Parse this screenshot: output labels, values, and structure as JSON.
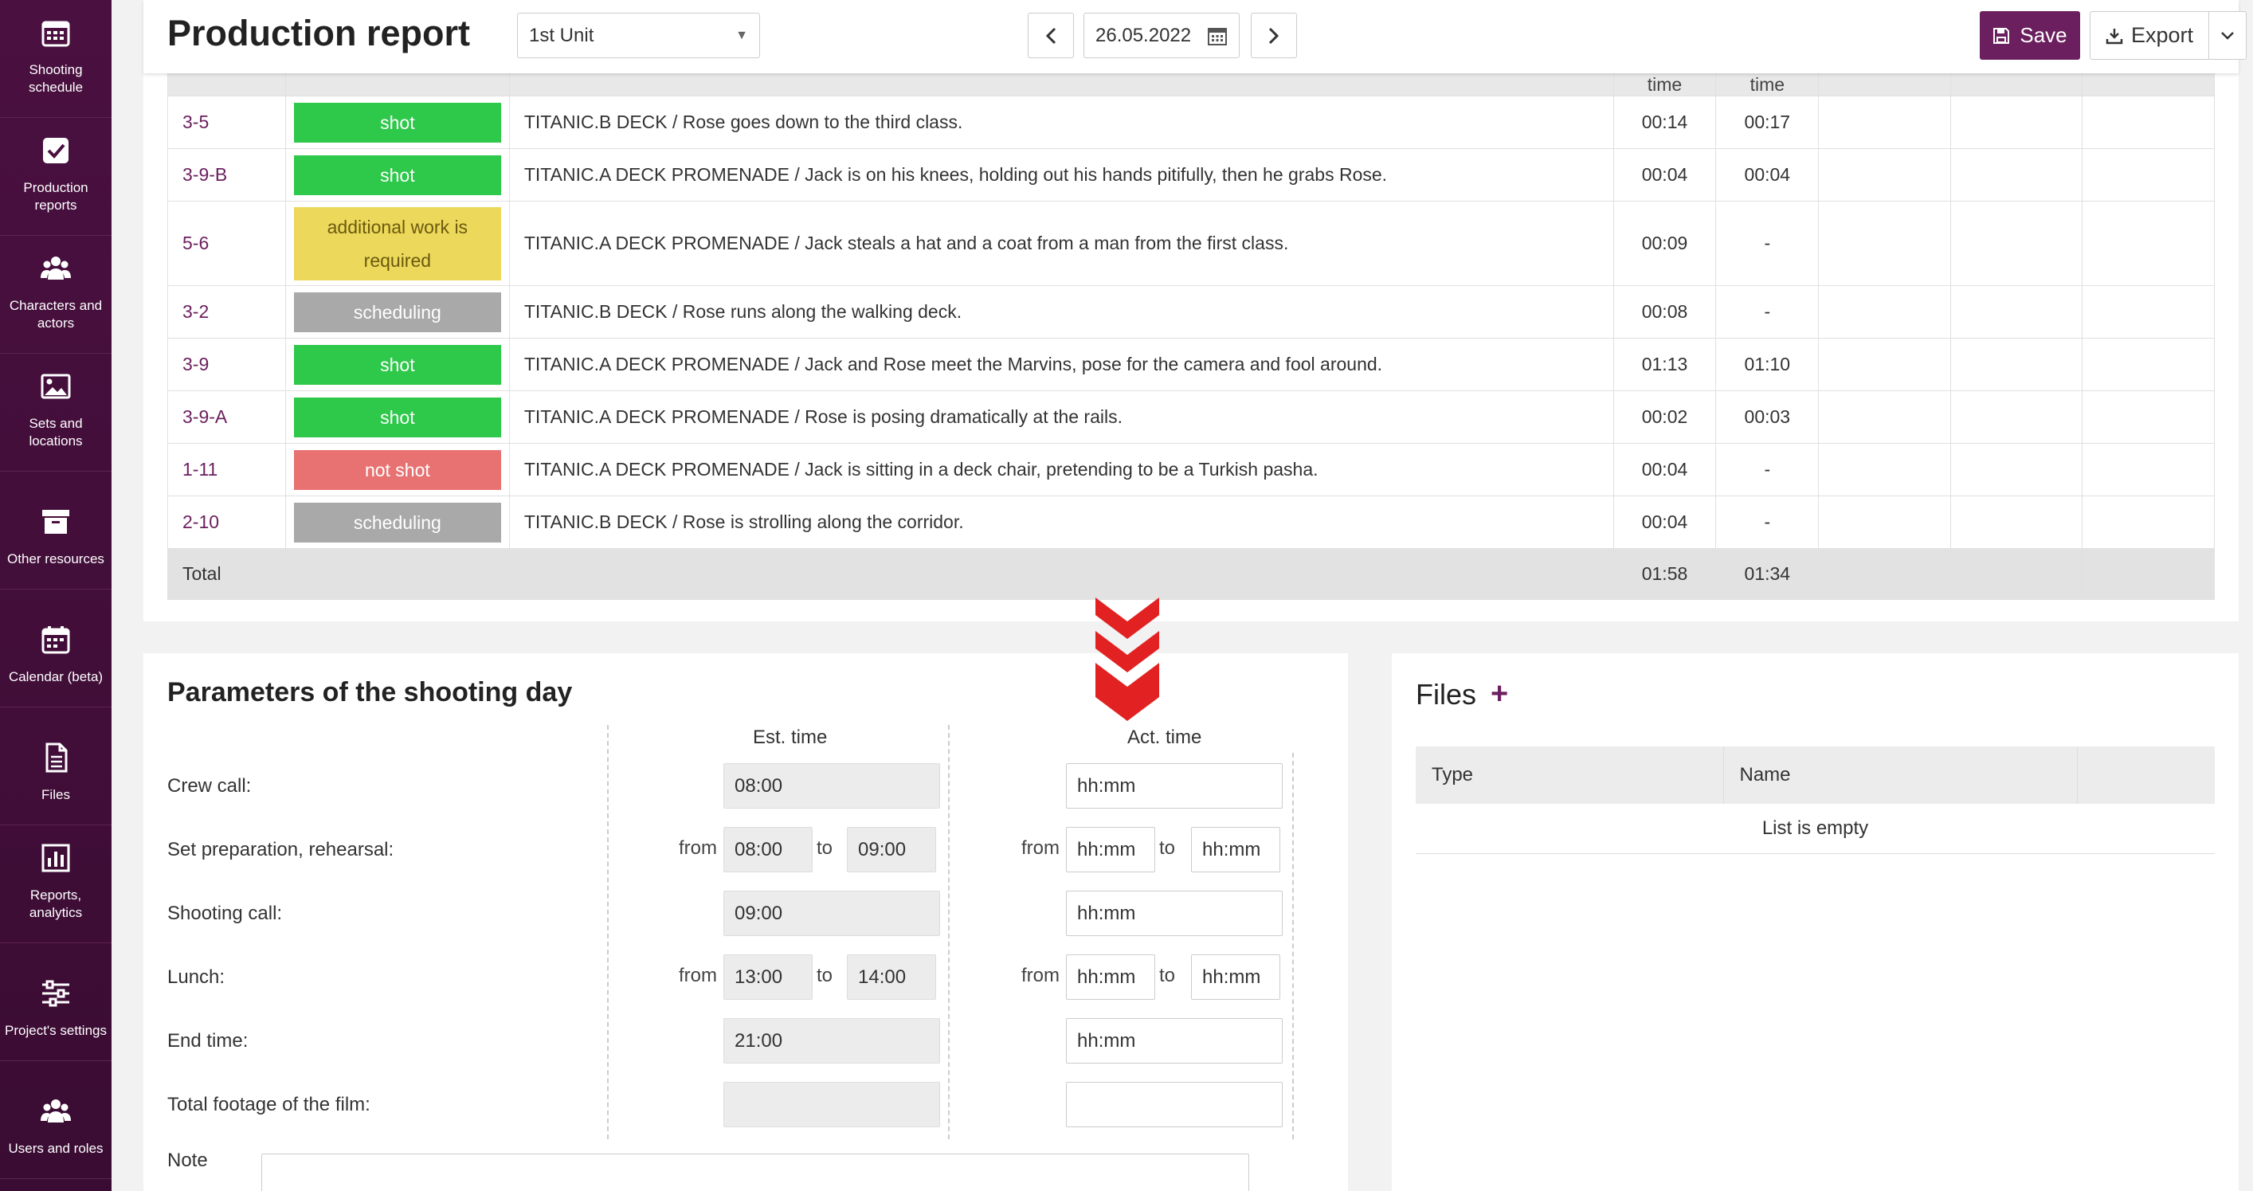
{
  "sidebar": {
    "items": [
      {
        "label": "Shooting schedule",
        "icon": "calendar-grid-icon"
      },
      {
        "label": "Production reports",
        "icon": "checkbox-icon"
      },
      {
        "label": "Characters and actors",
        "icon": "people-icon"
      },
      {
        "label": "Sets and locations",
        "icon": "image-icon"
      },
      {
        "label": "Other resources",
        "icon": "archive-box-icon"
      },
      {
        "label": "Calendar (beta)",
        "icon": "calendar-icon"
      },
      {
        "label": "Files",
        "icon": "file-icon"
      },
      {
        "label": "Reports, analytics",
        "icon": "bar-chart-icon"
      },
      {
        "label": "Project's settings",
        "icon": "sliders-icon"
      },
      {
        "label": "Users and roles",
        "icon": "users-icon"
      }
    ]
  },
  "header": {
    "title": "Production report",
    "unit": "1st Unit",
    "date": "26.05.2022",
    "save_label": "Save",
    "export_label": "Export"
  },
  "scenes": {
    "header": {
      "est": "time",
      "act": "time"
    },
    "rows": [
      {
        "no": "3-5",
        "status": "shot",
        "status_color": "#2ec84a",
        "desc": "TITANIC.B DECK / Rose goes down to the third class.",
        "est": "00:14",
        "act": "00:17"
      },
      {
        "no": "3-9-B",
        "status": "shot",
        "status_color": "#2ec84a",
        "desc": "TITANIC.A DECK PROMENADE / Jack is on his knees, holding out his hands pitifully, then he grabs Rose.",
        "est": "00:04",
        "act": "00:04"
      },
      {
        "no": "5-6",
        "status": "additional work is required",
        "status_color": "#ecd85a",
        "desc": "TITANIC.A DECK PROMENADE / Jack steals a hat and a coat from a man from the first class.",
        "est": "00:09",
        "act": "-"
      },
      {
        "no": "3-2",
        "status": "scheduling",
        "status_color": "#a9a9a9",
        "desc": "TITANIC.B DECK / Rose runs along the walking deck.",
        "est": "00:08",
        "act": "-"
      },
      {
        "no": "3-9",
        "status": "shot",
        "status_color": "#2ec84a",
        "desc": "TITANIC.A DECK PROMENADE / Jack and Rose meet the Marvins, pose for the camera and fool around.",
        "est": "01:13",
        "act": "01:10"
      },
      {
        "no": "3-9-A",
        "status": "shot",
        "status_color": "#2ec84a",
        "desc": "TITANIC.A DECK PROMENADE / Rose is posing dramatically at the rails.",
        "est": "00:02",
        "act": "00:03"
      },
      {
        "no": "1-11",
        "status": "not shot",
        "status_color": "#e87272",
        "desc": "TITANIC.A DECK PROMENADE / Jack is sitting in a deck chair, pretending to be a Turkish pasha.",
        "est": "00:04",
        "act": "-"
      },
      {
        "no": "2-10",
        "status": "scheduling",
        "status_color": "#a9a9a9",
        "desc": "TITANIC.B DECK / Rose is strolling along the corridor.",
        "est": "00:04",
        "act": "-"
      }
    ],
    "total": {
      "label": "Total",
      "est": "01:58",
      "act": "01:34"
    }
  },
  "params": {
    "title": "Parameters of the shooting day",
    "est_header": "Est. time",
    "act_header": "Act. time",
    "from_label": "from",
    "to_label": "to",
    "placeholder": "hh:mm",
    "crew_call": {
      "label": "Crew call:",
      "est": "08:00"
    },
    "set_prep": {
      "label": "Set preparation, rehearsal:",
      "est_from": "08:00",
      "est_to": "09:00"
    },
    "shooting_call": {
      "label": "Shooting call:",
      "est": "09:00"
    },
    "lunch": {
      "label": "Lunch:",
      "est_from": "13:00",
      "est_to": "14:00"
    },
    "end_time": {
      "label": "End time:",
      "est": "21:00"
    },
    "footage": {
      "label": "Total footage of the film:"
    },
    "note": {
      "label": "Note"
    }
  },
  "files": {
    "title": "Files",
    "col_type": "Type",
    "col_name": "Name",
    "empty": "List is empty"
  }
}
